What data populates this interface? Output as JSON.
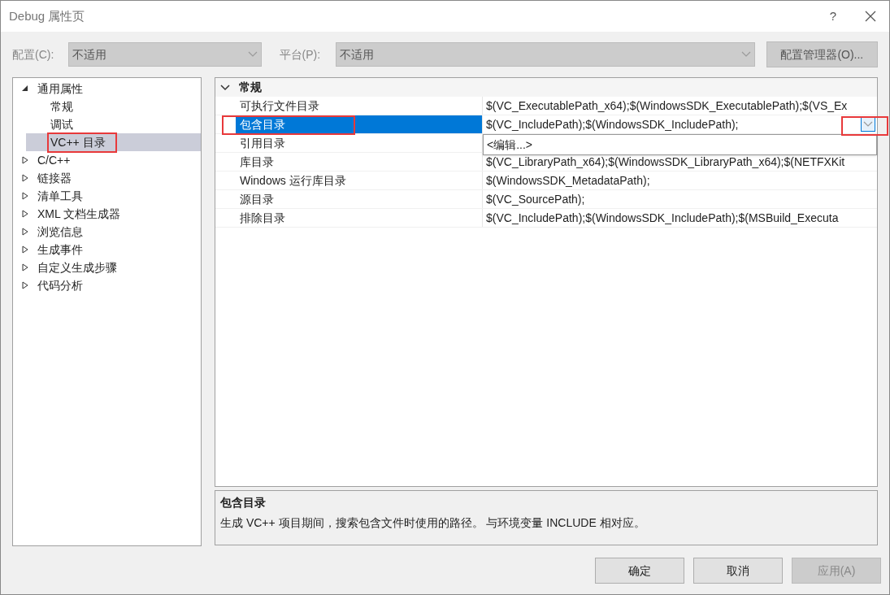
{
  "window": {
    "title": "Debug 属性页",
    "help": "?"
  },
  "config_bar": {
    "configuration": {
      "label": "配置(C):",
      "value": "不适用"
    },
    "platform": {
      "label": "平台(P):",
      "value": "不适用"
    },
    "manager_button": "配置管理器(O)..."
  },
  "tree": [
    {
      "label": "通用属性",
      "expanded": true,
      "selected": false,
      "annotated": false,
      "children": [
        {
          "label": "常规",
          "selected": false,
          "annotated": false
        },
        {
          "label": "调试",
          "selected": false,
          "annotated": false
        },
        {
          "label": "VC++ 目录",
          "selected": true,
          "annotated": true
        }
      ]
    },
    {
      "label": "C/C++",
      "expanded": false,
      "selected": false,
      "annotated": false
    },
    {
      "label": "链接器",
      "expanded": false,
      "selected": false,
      "annotated": false
    },
    {
      "label": "清单工具",
      "expanded": false,
      "selected": false,
      "annotated": false
    },
    {
      "label": "XML 文档生成器",
      "expanded": false,
      "selected": false,
      "annotated": false
    },
    {
      "label": "浏览信息",
      "expanded": false,
      "selected": false,
      "annotated": false
    },
    {
      "label": "生成事件",
      "expanded": false,
      "selected": false,
      "annotated": false
    },
    {
      "label": "自定义生成步骤",
      "expanded": false,
      "selected": false,
      "annotated": false
    },
    {
      "label": "代码分析",
      "expanded": false,
      "selected": false,
      "annotated": false
    }
  ],
  "grid": {
    "category": {
      "label": "常规",
      "expanded": true
    },
    "rows": [
      {
        "name": "可执行文件目录",
        "value": "$(VC_ExecutablePath_x64);$(WindowsSDK_ExecutablePath);$(VS_Ex",
        "selected": false,
        "annotated": false
      },
      {
        "name": "包含目录",
        "value": "$(VC_IncludePath);$(WindowsSDK_IncludePath);",
        "selected": true,
        "annotated": true,
        "dropdown_open": true,
        "dropdown_button_annotated": true,
        "dropdown_items": [
          "<编辑...>"
        ]
      },
      {
        "name": "引用目录",
        "selected": false,
        "annotated": false
      },
      {
        "name": "库目录",
        "value": "$(VC_LibraryPath_x64);$(WindowsSDK_LibraryPath_x64);$(NETFXKit",
        "selected": false,
        "annotated": false
      },
      {
        "name": "Windows 运行库目录",
        "value": "$(WindowsSDK_MetadataPath);",
        "selected": false,
        "annotated": false
      },
      {
        "name": "源目录",
        "value": "$(VC_SourcePath);",
        "selected": false,
        "annotated": false
      },
      {
        "name": "排除目录",
        "value": "$(VC_IncludePath);$(WindowsSDK_IncludePath);$(MSBuild_Executa",
        "selected": false,
        "annotated": false
      }
    ]
  },
  "description": {
    "title": "包含目录",
    "text": "生成 VC++ 项目期间，搜索包含文件时使用的路径。 与环境变量 INCLUDE 相对应。"
  },
  "buttons": [
    {
      "label": "确定",
      "disabled": false
    },
    {
      "label": "取消",
      "disabled": false
    },
    {
      "label": "应用(A)",
      "disabled": true
    }
  ]
}
